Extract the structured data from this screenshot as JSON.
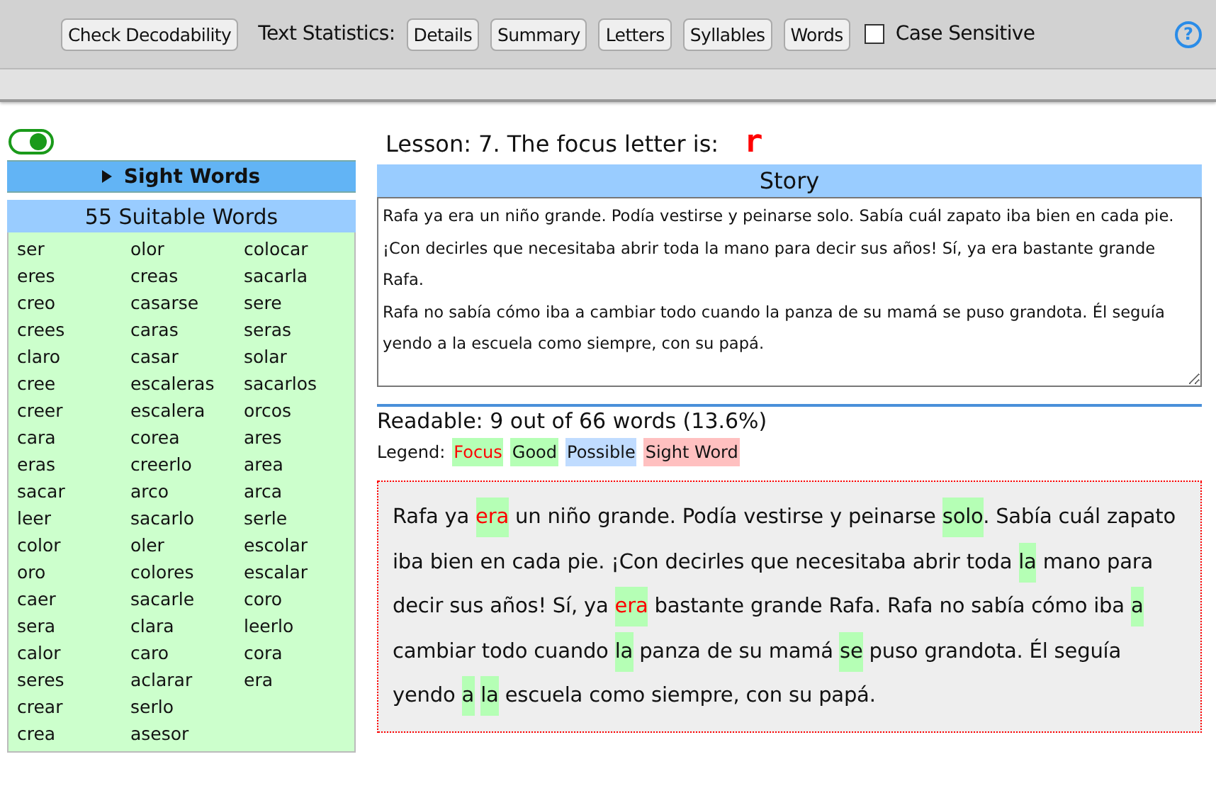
{
  "toolbar": {
    "check_button": "Check Decodability",
    "stats_label": "Text Statistics:",
    "stats_buttons": [
      "Details",
      "Summary",
      "Letters",
      "Syllables",
      "Words"
    ],
    "case_sensitive": {
      "label": "Case Sensitive",
      "checked": false
    },
    "help": "?"
  },
  "sidebar": {
    "toggle": {
      "on": true
    },
    "sight_words": {
      "label": "Sight Words",
      "expanded": false
    },
    "suitable_title": "55 Suitable Words",
    "words": [
      "ser",
      "eres",
      "creo",
      "crees",
      "claro",
      "cree",
      "creer",
      "cara",
      "eras",
      "sacar",
      "leer",
      "color",
      "oro",
      "caer",
      "sera",
      "calor",
      "seres",
      "crear",
      "crea",
      "olor",
      "creas",
      "casarse",
      "caras",
      "casar",
      "escaleras",
      "escalera",
      "corea",
      "creerlo",
      "arco",
      "sacarlo",
      "oler",
      "colores",
      "sacarle",
      "clara",
      "caro",
      "aclarar",
      "serlo",
      "asesor",
      "colocar",
      "sacarla",
      "sere",
      "seras",
      "solar",
      "sacarlos",
      "orcos",
      "ares",
      "area",
      "arca",
      "serle",
      "escolar",
      "escalar",
      "coro",
      "leerlo",
      "cora",
      "era"
    ]
  },
  "lesson": {
    "label": "Lesson: 7. The focus letter is:",
    "letter": "r"
  },
  "story": {
    "title": "Story",
    "value": "Rafa ya era un niño grande. Podía vestirse y peinarse solo. Sabía cuál zapato iba bien en cada pie. ¡Con decirles que necesitaba abrir toda la mano para decir sus años! Sí, ya era bastante grande Rafa.\nRafa no sabía cómo iba a cambiar todo cuando la panza de su mamá se puso grandota. Él seguía yendo a la escuela como siempre, con su papá."
  },
  "readable": "Readable: 9 out of 66 words (13.6%)",
  "legend": {
    "label": "Legend:",
    "items": [
      {
        "label": "Focus",
        "kind": "focus"
      },
      {
        "label": "Good",
        "kind": "good"
      },
      {
        "label": "Possible",
        "kind": "possible"
      },
      {
        "label": "Sight Word",
        "kind": "sight"
      }
    ]
  },
  "analysis": [
    {
      "text": "Rafa ya ",
      "kind": "plain"
    },
    {
      "text": "era",
      "kind": "focus"
    },
    {
      "text": " un niño grande. Podía vestirse y peinarse ",
      "kind": "plain"
    },
    {
      "text": "solo",
      "kind": "good"
    },
    {
      "text": ". Sabía cuál zapato iba bien en cada pie. ¡Con decirles que necesitaba abrir toda ",
      "kind": "plain"
    },
    {
      "text": "la",
      "kind": "good"
    },
    {
      "text": " mano para decir sus años! Sí, ya ",
      "kind": "plain"
    },
    {
      "text": "era",
      "kind": "focus"
    },
    {
      "text": " bastante grande Rafa. Rafa no sabía cómo iba ",
      "kind": "plain"
    },
    {
      "text": "a",
      "kind": "good"
    },
    {
      "text": " cambiar todo cuando ",
      "kind": "plain"
    },
    {
      "text": "la",
      "kind": "good"
    },
    {
      "text": " panza de su mamá ",
      "kind": "plain"
    },
    {
      "text": "se",
      "kind": "good"
    },
    {
      "text": " puso grandota. Él seguía yendo ",
      "kind": "plain"
    },
    {
      "text": "a",
      "kind": "good"
    },
    {
      "text": "la",
      "kind": "good"
    },
    {
      "text": " escuela como siempre, con su papá.",
      "kind": "plain"
    }
  ]
}
